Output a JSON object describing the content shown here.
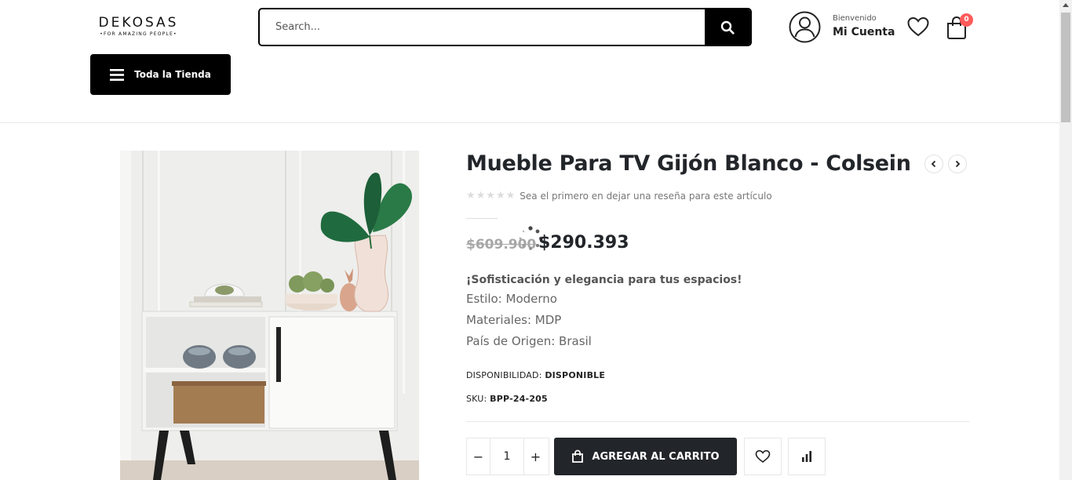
{
  "header": {
    "logo": "DEKOSAS",
    "tagline": "•FOR AMAZING PEOPLE•",
    "search_placeholder": "Search...",
    "account_greeting": "Bienvenido",
    "account_label": "Mi Cuenta",
    "cart_count": "0",
    "store_button": "Toda la Tienda"
  },
  "product": {
    "title": "Mueble Para TV Gijón Blanco - Colsein",
    "rating_stars": "★★★★★",
    "review_text": "Sea el primero en dejar una reseña para este artículo",
    "old_price": "$609.900",
    "new_price": "$290.393",
    "description_heading": "¡Sofisticación y elegancia para tus espacios!",
    "description_lines": [
      "Estilo: Moderno",
      "Materiales: MDP",
      "País de Origen: Brasil"
    ],
    "availability_label": "DISPONIBILIDAD:",
    "availability_value": "DISPONIBLE",
    "sku_label": "SKU:",
    "sku_value": "BPP-24-205",
    "quantity": "1",
    "minus": "−",
    "plus": "+",
    "add_to_cart": "AGREGAR AL CARRITO"
  },
  "icons": {
    "search": "search-icon",
    "account": "user-icon",
    "wishlist": "heart-icon",
    "cart": "shopping-bag-icon",
    "menu": "hamburger-icon",
    "prev": "chevron-left-icon",
    "next": "chevron-right-icon",
    "compare": "bar-chart-icon"
  },
  "colors": {
    "primary": "#000000",
    "button_dark": "#222529",
    "badge": "#ff5b5b",
    "old_price": "#a7a7a7"
  }
}
